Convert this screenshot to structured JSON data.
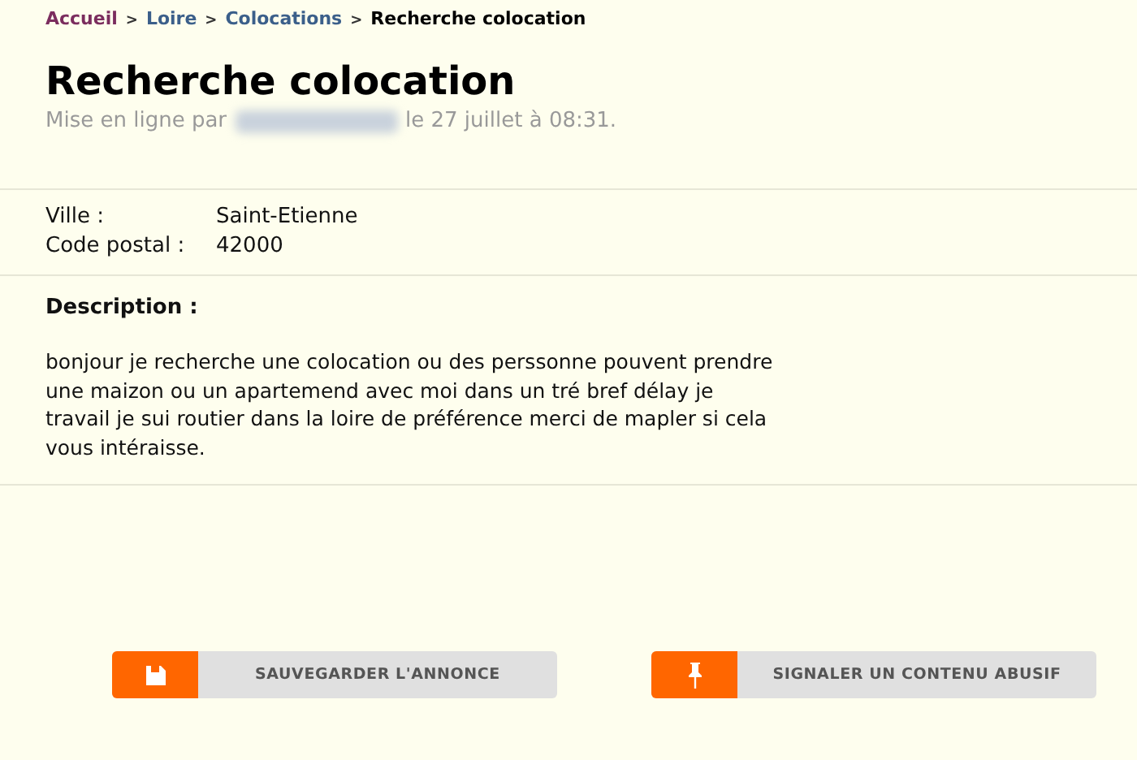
{
  "breadcrumb": [
    {
      "kind": "link",
      "label": "Accueil",
      "color": "#7b2d5e"
    },
    {
      "kind": "separator",
      "label": ">"
    },
    {
      "kind": "link",
      "label": "Loire",
      "color": "#3b5f8a"
    },
    {
      "kind": "separator",
      "label": ">"
    },
    {
      "kind": "link",
      "label": "Colocations",
      "color": "#3b5f8a"
    },
    {
      "kind": "separator",
      "label": ">"
    },
    {
      "kind": "current",
      "label": "Recherche colocation"
    }
  ],
  "title": "Recherche colocation",
  "posted": {
    "prefix": "Mise en ligne par",
    "author_hidden": true,
    "suffix": "le 27 juillet à 08:31."
  },
  "fields": [
    {
      "label": "Ville :",
      "value": "Saint-Etienne"
    },
    {
      "label": "Code postal :",
      "value": "42000"
    }
  ],
  "description": {
    "heading": "Description :",
    "text": "bonjour je recherche une colocation ou des perssonne pouvent prendre une maizon ou un apartemend avec moi dans un tré bref délay je travail je sui routier dans la loire de préférence merci de mapler si cela vous intéraisse."
  },
  "actions": [
    {
      "kind": "save",
      "label": "SAUVEGARDER L'ANNONCE"
    },
    {
      "kind": "report",
      "label": "SIGNALER UN CONTENU ABUSIF"
    }
  ]
}
